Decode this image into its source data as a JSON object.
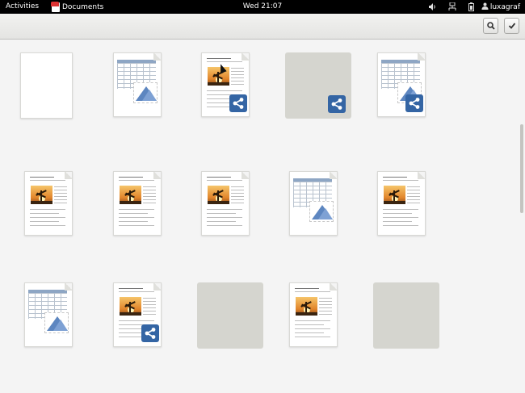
{
  "topbar": {
    "activities": "Activities",
    "app_name": "Documents",
    "clock": "Wed 21:07",
    "username": "luxagraf",
    "icons": [
      "volume-icon",
      "network-icon",
      "battery-icon",
      "user-icon"
    ]
  },
  "headerbar": {
    "search_icon": "search-icon",
    "select_icon": "checkmark-icon"
  },
  "items": [
    {
      "type": "blank",
      "shared": false,
      "title": "",
      "subtitle": ""
    },
    {
      "type": "spreadsheet",
      "shared": false,
      "title": "",
      "subtitle": ""
    },
    {
      "type": "document",
      "shared": true,
      "title": "",
      "subtitle": ""
    },
    {
      "type": "collection",
      "shared": true,
      "title": "",
      "subtitle": ""
    },
    {
      "type": "spreadsheet",
      "shared": true,
      "title": "",
      "subtitle": ""
    },
    {
      "type": "document",
      "shared": false,
      "title": "",
      "subtitle": ""
    },
    {
      "type": "document",
      "shared": false,
      "title": "",
      "subtitle": ""
    },
    {
      "type": "document",
      "shared": false,
      "title": "",
      "subtitle": ""
    },
    {
      "type": "spreadsheet",
      "shared": false,
      "title": "",
      "subtitle": ""
    },
    {
      "type": "document",
      "shared": false,
      "title": "",
      "subtitle": ""
    },
    {
      "type": "spreadsheet",
      "shared": false,
      "title": "",
      "subtitle": ""
    },
    {
      "type": "document",
      "shared": true,
      "title": "",
      "subtitle": ""
    },
    {
      "type": "collection",
      "shared": false,
      "title": "",
      "subtitle": ""
    },
    {
      "type": "document",
      "shared": false,
      "title": "",
      "subtitle": ""
    },
    {
      "type": "collection",
      "shared": false,
      "title": "",
      "subtitle": ""
    }
  ],
  "colors": {
    "topbar": "#000000",
    "share_badge": "#3465a4",
    "collection": "#d5d5cf",
    "background": "#f4f4f4"
  }
}
